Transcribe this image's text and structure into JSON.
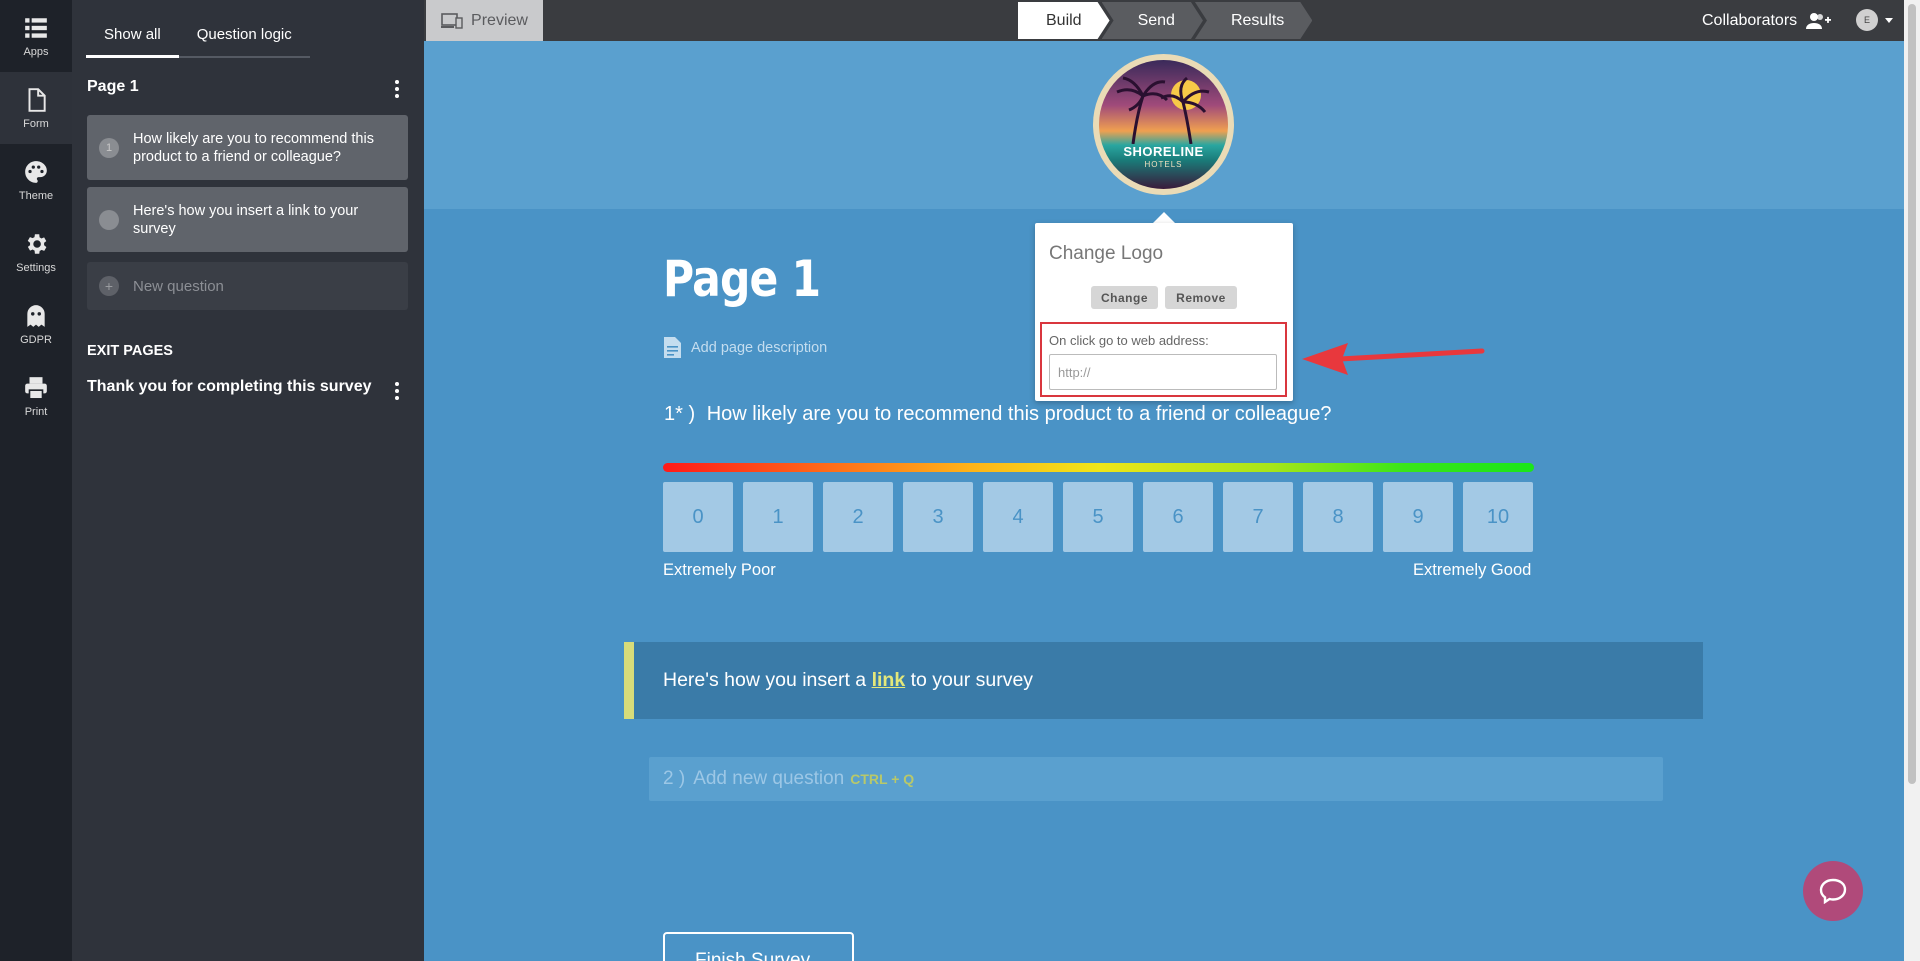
{
  "rail": {
    "items": [
      {
        "label": "Apps",
        "icon": "apps-icon"
      },
      {
        "label": "Form",
        "icon": "form-icon"
      },
      {
        "label": "Theme",
        "icon": "palette-icon"
      },
      {
        "label": "Settings",
        "icon": "gear-icon"
      },
      {
        "label": "GDPR",
        "icon": "ghost-icon"
      },
      {
        "label": "Print",
        "icon": "printer-icon"
      }
    ],
    "active": "Form"
  },
  "panel": {
    "tabs": [
      "Show all",
      "Question logic"
    ],
    "page_title": "Page 1",
    "questions": [
      {
        "num": "1",
        "text": "How likely are you to recommend this product to a friend or colleague?"
      },
      {
        "num": "",
        "text": "Here's how you insert a link to your survey"
      }
    ],
    "new_question": "New question",
    "exit_pages_heading": "EXIT PAGES",
    "exit_pages": [
      "Thank you for completing this survey"
    ]
  },
  "topbar": {
    "preview": "Preview",
    "steps": [
      "Build",
      "Send",
      "Results"
    ],
    "active_step": "Build",
    "collaborators": "Collaborators",
    "avatar_initial": "E"
  },
  "logo": {
    "line1": "SHORELINE",
    "line2": "HOTELS"
  },
  "popover": {
    "title": "Change Logo",
    "change_label": "Change",
    "remove_label": "Remove",
    "url_label": "On click go to web address:",
    "url_placeholder": "http://",
    "url_value": ""
  },
  "survey": {
    "page_title": "Page 1",
    "page_description_prompt": "Add page description",
    "question1": {
      "number": "1* )",
      "text": "How likely are you to recommend this product to a friend or colleague?",
      "scale": [
        "0",
        "1",
        "2",
        "3",
        "4",
        "5",
        "6",
        "7",
        "8",
        "9",
        "10"
      ],
      "low_label": "Extremely Poor",
      "high_label": "Extremely Good"
    },
    "text_block": {
      "before": "Here's how you insert a ",
      "link": "link",
      "after": " to your survey"
    },
    "add_question": {
      "number": "2 )",
      "text": "Add new question",
      "shortcut": "CTRL + Q"
    },
    "finish_button": "Finish Survey"
  },
  "colors": {
    "rail_bg": "#1e2229",
    "panel_bg": "#2f333b",
    "canvas_bg": "#4a93c6",
    "header_bg": "#5aa0cf",
    "highlight_red": "#d9363e",
    "chat_bubble": "#b04a7a"
  }
}
